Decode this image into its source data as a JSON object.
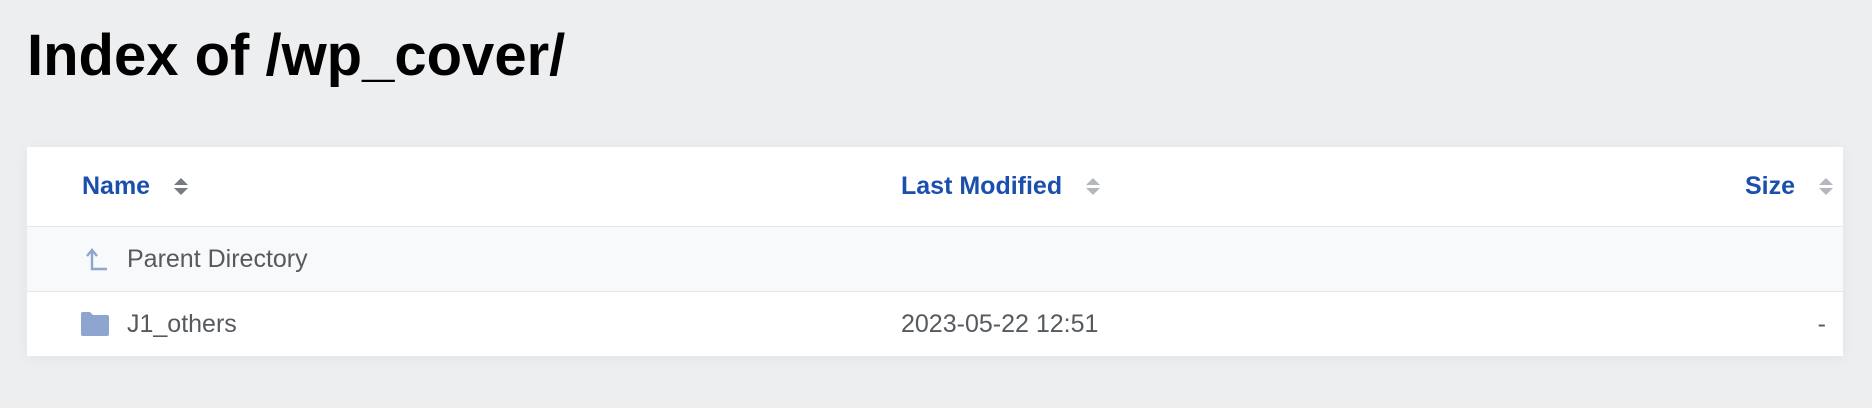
{
  "page": {
    "title": "Index of /wp_cover/"
  },
  "table": {
    "columns": {
      "name": "Name",
      "last_modified": "Last Modified",
      "size": "Size"
    },
    "parent": {
      "label": "Parent Directory",
      "icon": "parent-directory-arrow-icon"
    },
    "rows": [
      {
        "name": "J1_others",
        "last_modified": "2023-05-22 12:51",
        "size": "-",
        "icon": "folder-icon"
      }
    ]
  },
  "colors": {
    "background": "#eceef0",
    "link": "#1a4fad",
    "icon": "#8ea5cf",
    "text": "#555a5f"
  }
}
